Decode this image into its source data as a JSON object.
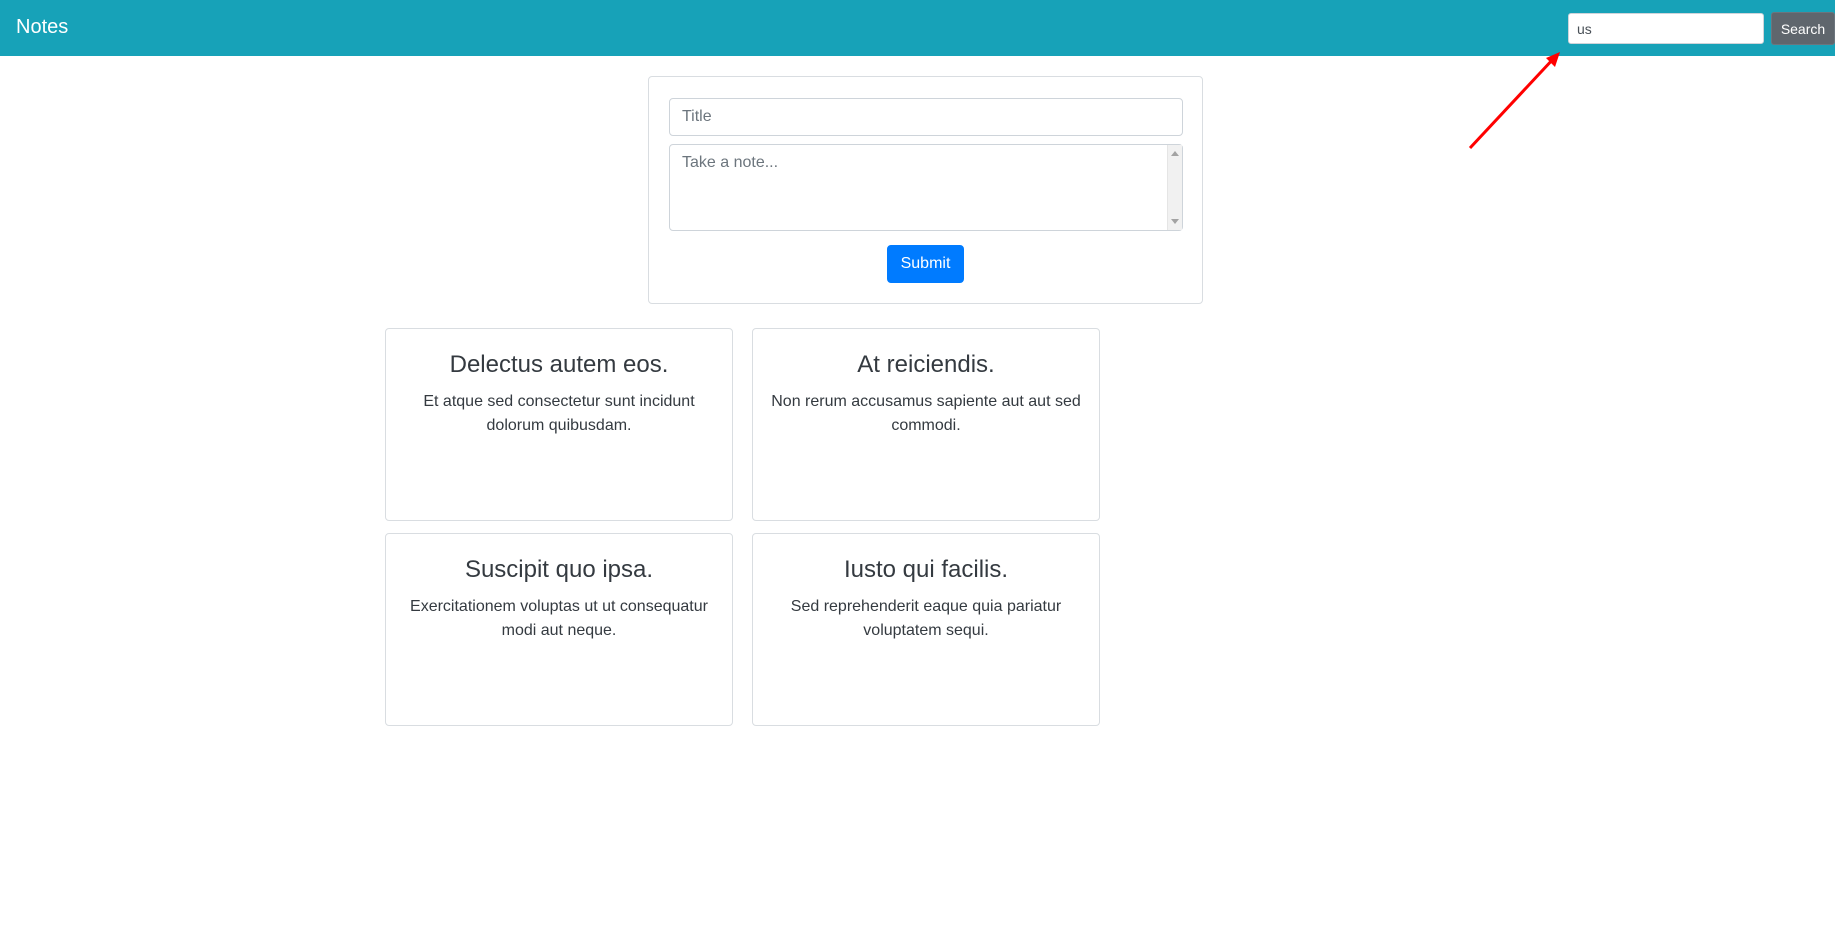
{
  "navbar": {
    "brand": "Notes",
    "search": {
      "value": "us",
      "button_label": "Search"
    },
    "color": "#17a2b8"
  },
  "form": {
    "title_placeholder": "Title",
    "note_placeholder": "Take a note...",
    "submit_label": "Submit"
  },
  "notes": [
    {
      "title": "Delectus autem eos.",
      "body": "Et atque sed consectetur sunt incidunt dolorum quibusdam."
    },
    {
      "title": "At reiciendis.",
      "body": "Non rerum accusamus sapiente aut aut sed commodi."
    },
    {
      "title": "Suscipit quo ipsa.",
      "body": "Exercitationem voluptas ut ut consequatur modi aut neque."
    },
    {
      "title": "Iusto qui facilis.",
      "body": "Sed reprehenderit eaque quia pariatur voluptatem sequi."
    }
  ],
  "annotation": {
    "arrow_color": "#ff0000",
    "icon": "arrow-icon"
  }
}
